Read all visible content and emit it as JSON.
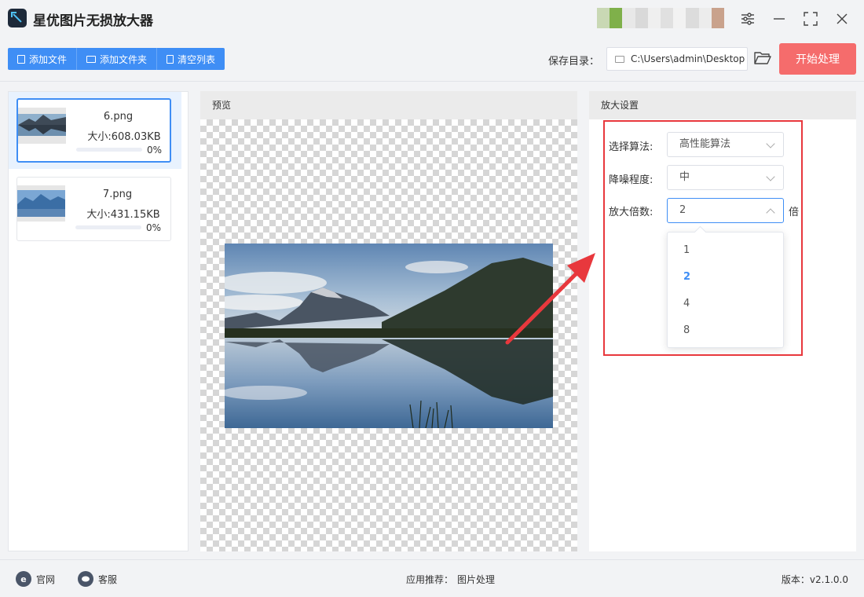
{
  "app": {
    "title": "星优图片无损放大器"
  },
  "window_controls": [
    "settings-icon",
    "minimize-icon",
    "maximize-icon",
    "close-icon"
  ],
  "toolbar": {
    "add_file": "添加文件",
    "add_folder": "添加文件夹",
    "clear_list": "清空列表",
    "save_dir_label": "保存目录：",
    "save_dir_value": "C:\\Users\\admin\\Desktop",
    "start_button": "开始处理"
  },
  "files": [
    {
      "name": "6.png",
      "size": "大小:608.03KB",
      "progress": 0,
      "progress_text": "0%",
      "selected": true
    },
    {
      "name": "7.png",
      "size": "大小:431.15KB",
      "progress": 0,
      "progress_text": "0%",
      "selected": false
    }
  ],
  "preview": {
    "title": "预览"
  },
  "settings": {
    "title": "放大设置",
    "algorithm": {
      "label": "选择算法:",
      "value": "高性能算法"
    },
    "denoise": {
      "label": "降噪程度:",
      "value": "中"
    },
    "scale": {
      "label": "放大倍数:",
      "value": "2",
      "unit": "倍",
      "options": [
        "1",
        "2",
        "4",
        "8"
      ],
      "selected": "2"
    }
  },
  "footer": {
    "website": "官网",
    "service": "客服",
    "recommend_label": "应用推荐：",
    "recommend_link": "图片处理",
    "version": "版本：v2.1.0.0"
  },
  "colors": {
    "primary": "#3f8ef5",
    "start_button": "#f56c6c",
    "highlight": "#e8383d"
  }
}
